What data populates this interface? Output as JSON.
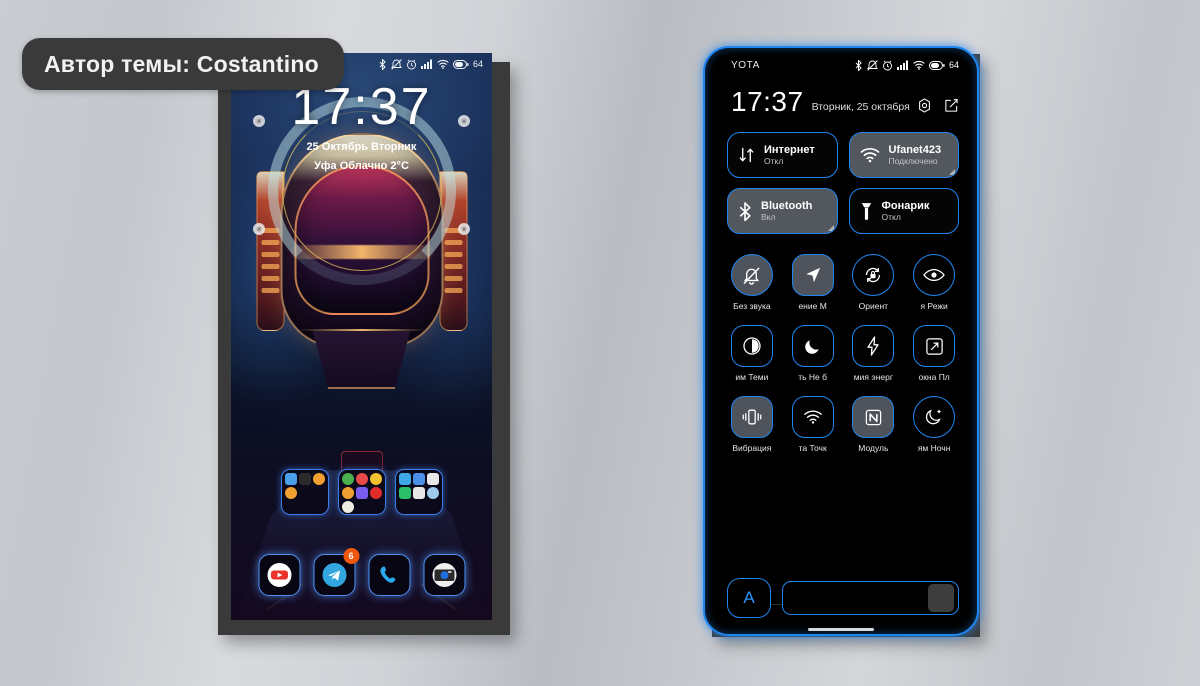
{
  "badge": {
    "text": "Автор темы: Costantino"
  },
  "phone_home": {
    "status_bar": {
      "icons": [
        "bluetooth-icon",
        "mute-icon",
        "alarm-icon",
        "signal-icon",
        "wifi-icon",
        "battery-icon"
      ],
      "battery_percent": "64"
    },
    "clock_widget": {
      "time": "17:37",
      "date": "25 Октябрь Вторник",
      "weather": "Уфа   Облачно   2°C"
    },
    "folders": [
      {
        "name": "folder-1",
        "colors": [
          "#4a9fe8",
          "#2b2b2b",
          "#f0a030",
          "#f0a030"
        ]
      },
      {
        "name": "folder-2",
        "colors": [
          "#4caf50",
          "#e84a4a",
          "#f2c230",
          "#f0a030",
          "#7a5cf0",
          "#e02b2b",
          "#f0ece0"
        ]
      },
      {
        "name": "folder-3",
        "colors": [
          "#3ea7e8",
          "#4a8fe8",
          "#e8e8e8",
          "#2bbf6a",
          "#e8e8e8",
          "#9fc9ef"
        ]
      }
    ],
    "dock": [
      {
        "name": "youtube-icon",
        "label": "YouTube",
        "badge": ""
      },
      {
        "name": "telegram-icon",
        "label": "Telegram",
        "badge": "6"
      },
      {
        "name": "phone-icon",
        "label": "Телефон",
        "badge": ""
      },
      {
        "name": "camera-icon",
        "label": "Камера",
        "badge": ""
      }
    ]
  },
  "phone_shade": {
    "status_bar": {
      "carrier": "YOTA",
      "icons": [
        "bluetooth-icon",
        "mute-icon",
        "alarm-icon",
        "signal-icon",
        "wifi-icon",
        "battery-icon"
      ],
      "battery_percent": "64"
    },
    "header": {
      "time": "17:37",
      "date": "Вторник, 25 октября",
      "icons": [
        "settings-icon",
        "edit-icon"
      ]
    },
    "big_tiles": [
      {
        "title": "Интернет",
        "sub": "Откл",
        "state": "off",
        "icon": "data-transfer-icon"
      },
      {
        "title": "Ufanet423",
        "sub": "Подключено",
        "state": "on",
        "icon": "wifi-icon"
      },
      {
        "title": "Bluetooth",
        "sub": "Вкл",
        "state": "on",
        "icon": "bluetooth-icon"
      },
      {
        "title": "Фонарик",
        "sub": "Откл",
        "state": "off",
        "icon": "flashlight-icon"
      }
    ],
    "quick_tiles": [
      {
        "label": "Без звука",
        "state": "on",
        "icon": "bell-muted-icon",
        "shape": "round"
      },
      {
        "label": "ение      М",
        "state": "on",
        "icon": "location-icon",
        "shape": "rounded"
      },
      {
        "label": "Ориент",
        "state": "off",
        "icon": "rotation-lock-icon",
        "shape": "round"
      },
      {
        "label": "я      Режи",
        "state": "off",
        "icon": "eye-icon",
        "shape": "round"
      },
      {
        "label": "им     Теми",
        "state": "off",
        "icon": "contrast-icon",
        "shape": "rounded"
      },
      {
        "label": "ть     Не б",
        "state": "off",
        "icon": "moon-icon",
        "shape": "rounded"
      },
      {
        "label": "мия энерг",
        "state": "off",
        "icon": "battery-saver-icon",
        "shape": "rounded"
      },
      {
        "label": "окна      Пл",
        "state": "off",
        "icon": "expand-icon",
        "shape": "rounded"
      },
      {
        "label": "Вибрация",
        "state": "on",
        "icon": "vibration-icon",
        "shape": "rounded"
      },
      {
        "label": "та     Точк",
        "state": "off",
        "icon": "hotspot-icon",
        "shape": "rounded"
      },
      {
        "label": "Модуль",
        "state": "on",
        "icon": "nfc-icon",
        "shape": "rounded"
      },
      {
        "label": "ям     Ночн",
        "state": "off",
        "icon": "night-mode-icon",
        "shape": "rounded"
      }
    ],
    "brightness": {
      "auto_label": "A",
      "value_percent": "88"
    }
  },
  "colors": {
    "accent_blue": "#1f86f0",
    "badge_orange": "#f0560d",
    "frame_gray": "#3a3a3a",
    "tile_on": "#53575e"
  }
}
